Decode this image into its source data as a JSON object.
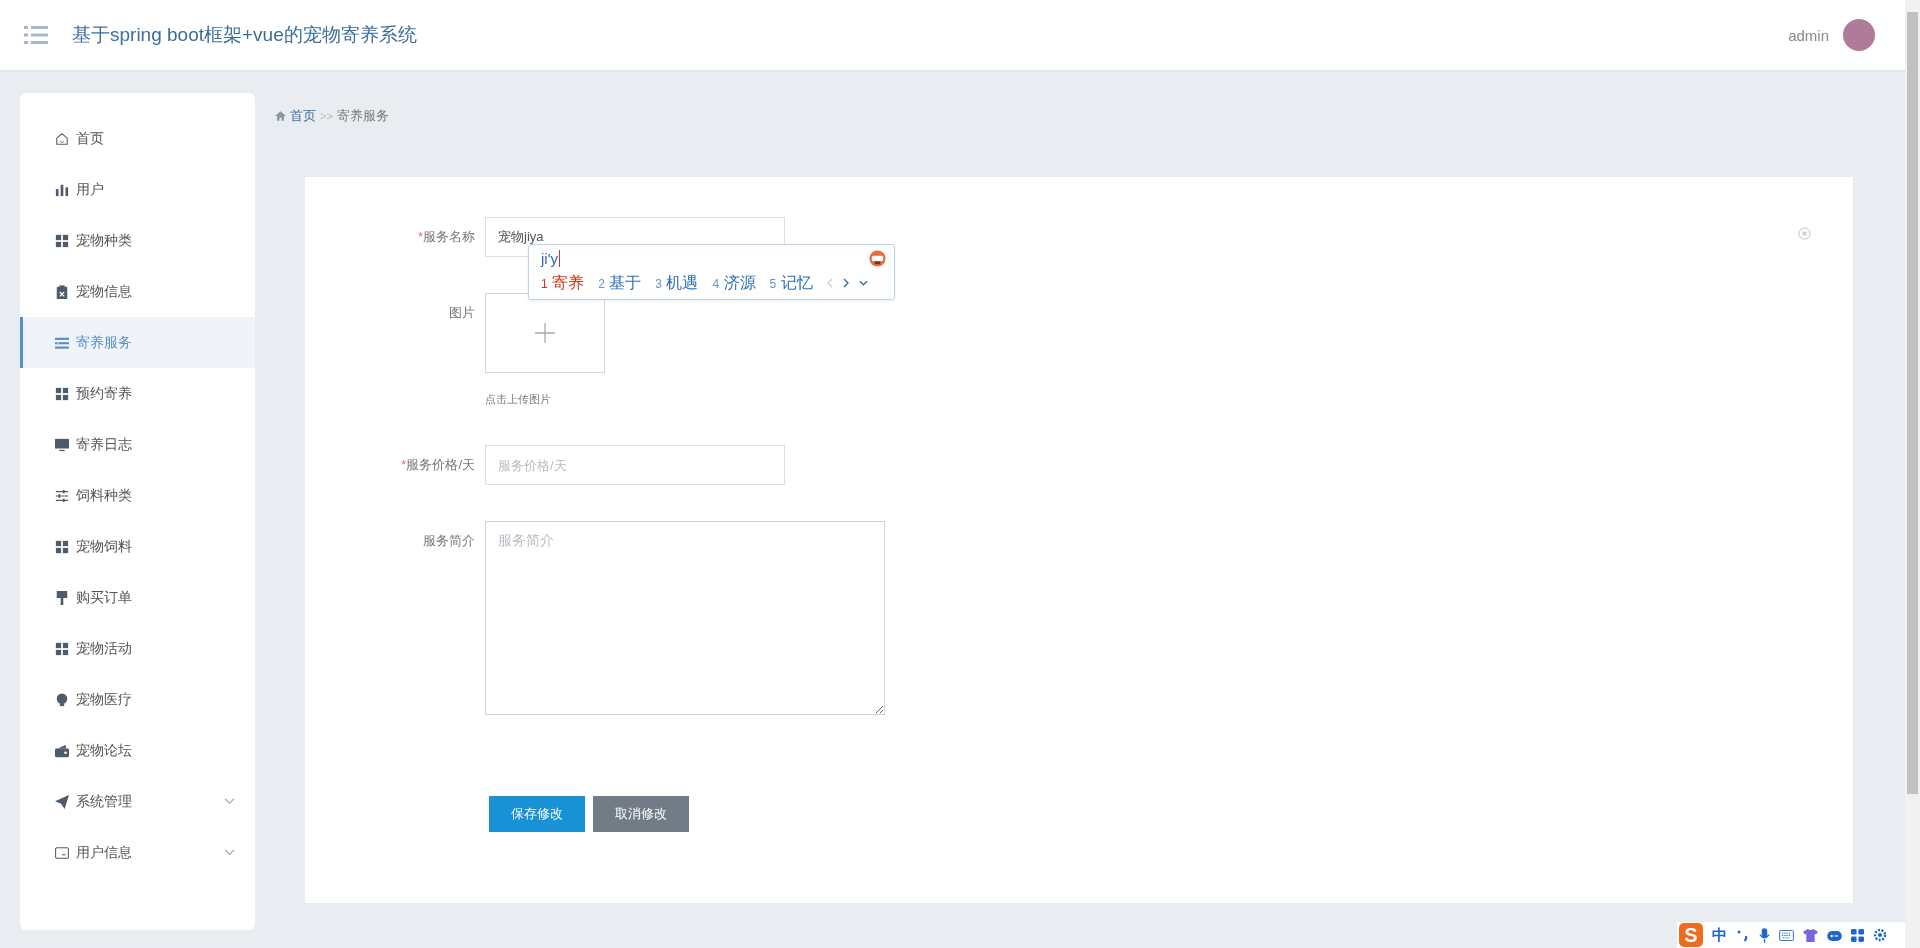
{
  "header": {
    "title": "基于spring boot框架+vue的宠物寄养系统",
    "username": "admin"
  },
  "sidebar": {
    "items": [
      {
        "label": "首页",
        "kind": "link",
        "selected": false
      },
      {
        "label": "用户",
        "kind": "link",
        "selected": false
      },
      {
        "label": "宠物种类",
        "kind": "link",
        "selected": false
      },
      {
        "label": "宠物信息",
        "kind": "link",
        "selected": false
      },
      {
        "label": "寄养服务",
        "kind": "link",
        "selected": true
      },
      {
        "label": "预约寄养",
        "kind": "link",
        "selected": false
      },
      {
        "label": "寄养日志",
        "kind": "link",
        "selected": false
      },
      {
        "label": "饲料种类",
        "kind": "link",
        "selected": false
      },
      {
        "label": "宠物饲料",
        "kind": "link",
        "selected": false
      },
      {
        "label": "购买订单",
        "kind": "link",
        "selected": false
      },
      {
        "label": "宠物活动",
        "kind": "link",
        "selected": false
      },
      {
        "label": "宠物医疗",
        "kind": "link",
        "selected": false
      },
      {
        "label": "宠物论坛",
        "kind": "link",
        "selected": false
      },
      {
        "label": "系统管理",
        "kind": "group",
        "selected": false,
        "expanded": false
      },
      {
        "label": "用户信息",
        "kind": "group",
        "selected": false,
        "expanded": false
      }
    ]
  },
  "breadcrumb": {
    "items": [
      {
        "label": "首页",
        "kind": "link"
      },
      {
        "label": "寄养服务",
        "kind": "current"
      }
    ],
    "separator": ">>"
  },
  "form": {
    "required_mark": "*",
    "fields": [
      {
        "kind": "text",
        "label": "服务名称",
        "required": true,
        "value": "宠物jiya"
      },
      {
        "kind": "upload",
        "label": "图片",
        "required": false,
        "hint": "点击上传图片"
      },
      {
        "kind": "text",
        "label": "服务价格/天",
        "required": true,
        "placeholder": "服务价格/天"
      },
      {
        "kind": "textarea",
        "label": "服务简介",
        "required": false,
        "placeholder": "服务简介"
      }
    ],
    "buttons": [
      {
        "label": "保存修改",
        "kind": "primary"
      },
      {
        "label": "取消修改",
        "kind": "secondary"
      }
    ]
  },
  "ime_popup": {
    "composition": "ji'y",
    "candidates": [
      {
        "number": "1",
        "text": "寄养",
        "selected": true
      },
      {
        "number": "2",
        "text": "基于",
        "selected": false
      },
      {
        "number": "3",
        "text": "机遇",
        "selected": false
      },
      {
        "number": "4",
        "text": "济源",
        "selected": false
      },
      {
        "number": "5",
        "text": "记忆",
        "selected": false
      }
    ]
  },
  "ime_toolbar": {
    "logo": "S",
    "mode": "中"
  }
}
